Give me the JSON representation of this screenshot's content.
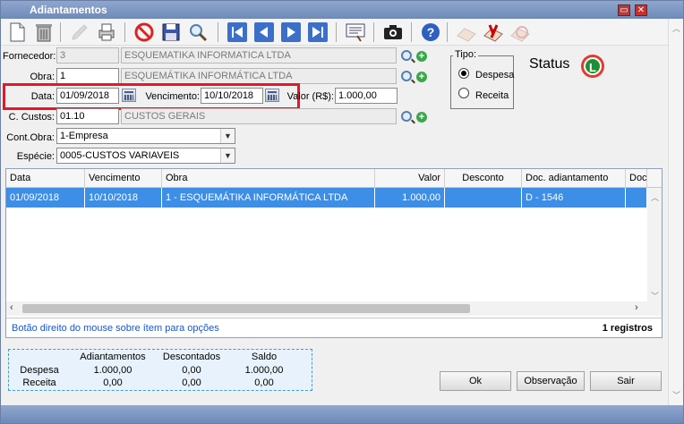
{
  "window": {
    "title": "Adiantamentos"
  },
  "form": {
    "fornecedor": {
      "label": "Fornecedor:",
      "code": "3",
      "name": "ESQUEMATIKA INFORMATICA LTDA"
    },
    "obra": {
      "label": "Obra:",
      "code": "1",
      "name": "ESQUEMÁTIKA INFORMÁTICA LTDA"
    },
    "data": {
      "label": "Data:",
      "value": "01/09/2018"
    },
    "vencimento": {
      "label": "Vencimento:",
      "value": "10/10/2018"
    },
    "valor": {
      "label": "Valor (R$):",
      "value": "1.000,00"
    },
    "ccustos": {
      "label": "C. Custos:",
      "code": "01.10",
      "name": "CUSTOS GERAIS"
    },
    "contobra": {
      "label": "Cont.Obra:",
      "value": "1-Empresa"
    },
    "especie": {
      "label": "Espécie:",
      "value": "0005-CUSTOS VARIAVEIS"
    }
  },
  "tipo": {
    "label": "Tipo:",
    "options": [
      "Despesa",
      "Receita"
    ],
    "selected": "Despesa"
  },
  "status": {
    "label": "Status",
    "icon_letter": "L"
  },
  "grid": {
    "columns": [
      "Data",
      "Vencimento",
      "Obra",
      "Valor",
      "Desconto",
      "Doc. adiantamento",
      "Doc"
    ],
    "rows": [
      [
        "01/09/2018",
        "10/10/2018",
        "1 - ESQUEMÁTIKA INFORMÁTICA LTDA",
        "1.000,00",
        "",
        "D - 1546",
        ""
      ]
    ],
    "hint": "Botão direito do mouse sobre ítem para opções",
    "count": "1 registros"
  },
  "summary": {
    "headers": [
      "Adiantamentos",
      "Descontados",
      "Saldo"
    ],
    "rows": [
      {
        "label": "Despesa",
        "values": [
          "1.000,00",
          "0,00",
          "1.000,00"
        ]
      },
      {
        "label": "Receita",
        "values": [
          "0,00",
          "0,00",
          "0,00"
        ]
      }
    ]
  },
  "buttons": {
    "ok": "Ok",
    "observacao": "Observação",
    "sair": "Sair"
  },
  "colors": {
    "highlight": "#e0192a",
    "selection": "#3d8ee6",
    "titlebar": "#7a92c0"
  }
}
